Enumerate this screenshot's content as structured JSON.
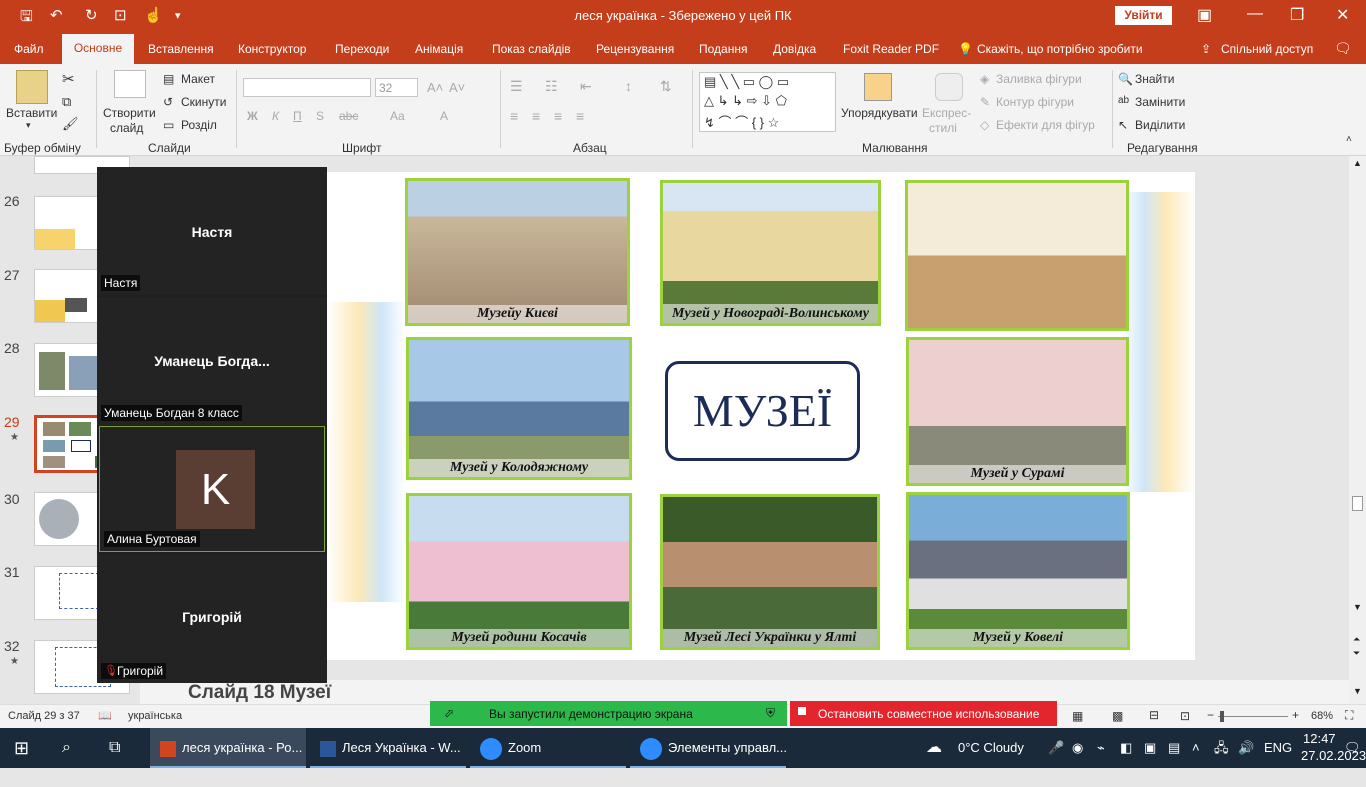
{
  "window": {
    "title": "леся українка  -  Збережено у цей ПК",
    "signin": "Увійти"
  },
  "tabs": [
    "Файл",
    "Основне",
    "Вставлення",
    "Конструктор",
    "Переходи",
    "Анімація",
    "Показ слайдів",
    "Рецензування",
    "Подання",
    "Довідка",
    "Foxit Reader PDF",
    "Скажіть, що потрібно зробити",
    "Спільний доступ"
  ],
  "ribbon": {
    "paste": "Вставити",
    "new_slide": "Створити",
    "new_slide2": "слайд",
    "layout": "Макет",
    "reset": "Скинути",
    "section": "Розділ",
    "font_size": "32",
    "arrange": "Упорядкувати",
    "quick_styles": "Експрес-",
    "quick_styles2": "стилі",
    "shape_fill": "Заливка фігури",
    "shape_outline": "Контур фігури",
    "shape_effects": "Ефекти для фігур",
    "find": "Знайти",
    "replace": "Замінити",
    "select": "Виділити",
    "groups": {
      "clipboard": "Буфер обміну",
      "slides": "Слайди",
      "font": "Шрифт",
      "paragraph": "Абзац",
      "drawing": "Малювання",
      "editing": "Редагування"
    }
  },
  "thumbnails": [
    {
      "num": "26",
      "star": ""
    },
    {
      "num": "27",
      "star": ""
    },
    {
      "num": "28",
      "star": ""
    },
    {
      "num": "29",
      "star": "★"
    },
    {
      "num": "30",
      "star": ""
    },
    {
      "num": "31",
      "star": ""
    },
    {
      "num": "32",
      "star": "★"
    }
  ],
  "zoom": {
    "participants": [
      {
        "name": "Настя",
        "label": "Настя"
      },
      {
        "name": "Уманець  Богда...",
        "label": "Уманець Богдан 8 класс"
      },
      {
        "initial": "K",
        "label": "Алина Буртовая"
      },
      {
        "name": "Григорій",
        "label": "Григорій"
      }
    ],
    "share_status": "Вы запустили демонстрацию экрана",
    "stop_share": "Остановить совместное использование"
  },
  "slide": {
    "center_title": "МУЗЕЇ",
    "captions": [
      "Музейу Києві",
      "Музей у Новограді-Волинському",
      "",
      "Музей у Колодяжному",
      "Музей у  Сурамі",
      "Музей родини Косачів",
      "Музей Лесі Українки у Ялті",
      "Музей у Ковелі"
    ]
  },
  "notes": {
    "title": "Слайд 18 Музеї"
  },
  "status": {
    "slide_count": "Слайд 29 з 37",
    "language": "українська",
    "zoom": "68%"
  },
  "taskbar": {
    "items": [
      "леся українка - Ро...",
      "Леся Українка - W...",
      "Zoom",
      "Элементы управл..."
    ],
    "weather": "0°C  Cloudy",
    "lang": "ENG",
    "time": "12:47",
    "date": "27.02.2023"
  },
  "colors": {
    "accent": "#c43e1c",
    "photo_border": "#9cd33c",
    "title_blue": "#1c2c57",
    "share_green": "#2db84b",
    "stop_red": "#e3262d"
  }
}
